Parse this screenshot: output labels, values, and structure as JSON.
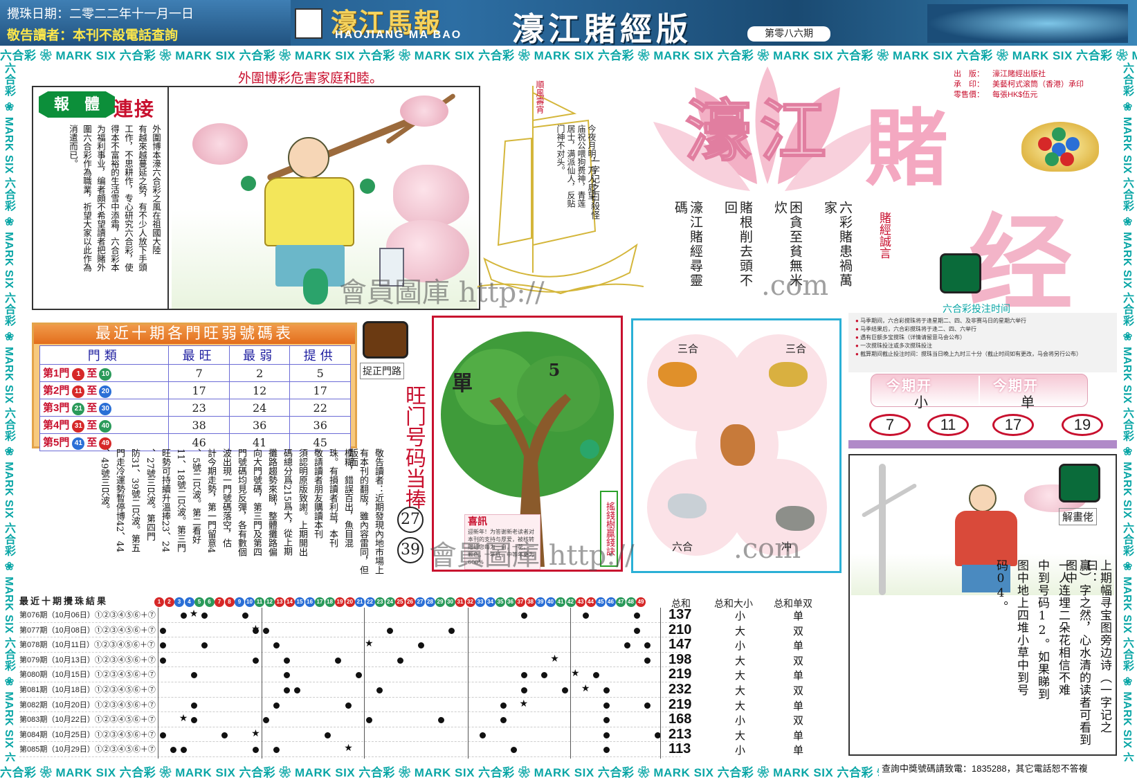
{
  "header": {
    "draw_date": "攪珠日期：二零二二年十一月一日",
    "notice": "敬告讀者：本刊不設電話查詢",
    "logo_cn": "濠江馬報",
    "logo_en": "HAOJIANG MA BAO",
    "edition": "濠江賭經版",
    "issue": "第零八六期"
  },
  "border_text": "六合彩 ❀ MARK SIX 六合彩 ❀ MARK SIX 六合彩 ❀ MARK SIX 六合彩 ❀ MARK SIX 六合彩 ❀ MARK SIX 六合彩 ❀ MARK SIX 六合彩 ❀ MARK SIX 六合彩 ❀ MARK SIX 六合彩 ❀ MARK SIX 六合彩 ❀ MARK SIX 六合彩 ❀",
  "slogan": "外圍博彩危害家庭和睦。",
  "lianjie": {
    "tag1": "報",
    "tag2": "體",
    "title": "連接",
    "body": [
      "外圍博本濠六合彩之風在祖國大陸",
      "有越來越蔓延之勢，有不少人放下手頭",
      "工作，不思耕作，专心研究六合彩，使",
      "得本不富裕的生活雪中添霜，六合彩本",
      "为福利事业，编者頗不希望讀者把賭外",
      "圍六合彩作為職業，祈望大家以此作為",
      "消遣而已。"
    ]
  },
  "ship": {
    "sail_text": "順風壽宵",
    "poem1": "今夜月明，万人启望，庙祝公喂狗费神，青莲居士，满派仙人，反贴门神不对头。",
    "poem2": "一字记之曰殺怪"
  },
  "title": {
    "t1": "濠江",
    "t2": "賭",
    "t3": "经"
  },
  "pub_info": [
    {
      "label": "出　版：",
      "value": "濠江賭經出版社"
    },
    {
      "label": "承　印：",
      "value": "美藝柯式滚筒（香港）承印"
    },
    {
      "label": "零售價：",
      "value": "每張HK$伍元"
    }
  ],
  "mottos": [
    "六彩賭患禍萬家",
    "困貪至貧無米炊",
    "賭根削去頭不回",
    "濠江賭經尋靈碼"
  ],
  "motto_red": "賭經誠言",
  "schedule": {
    "title": "六合彩投注时间",
    "items": [
      "马季期间，六合彩搅珠将于逢星期二、四、及非赛马日的星期六举行",
      "马季结果后，六合彩搅珠将于逢二、四、六举行",
      "遇有巨额多宝搅珠（详情请留意马会公布）",
      "一次搅珠投注或多次搅珠投注",
      "截算期间截止投注时间：搅珠当日晚上九时三十分（截止时间如有更改，马会将另行公布）"
    ]
  },
  "this_period": {
    "label1": "今期开",
    "value1": "小",
    "label2": "今期开",
    "value2": "单",
    "numbers": [
      "7",
      "11",
      "17",
      "19"
    ]
  },
  "hot_cold": {
    "title": "最近十期各門旺弱號碼表",
    "headers": [
      "門類",
      "最旺",
      "最弱",
      "提供"
    ],
    "rows": [
      {
        "gate": "第1門",
        "from": "1",
        "to": "10",
        "hot": "7",
        "cold": "2",
        "give": "5"
      },
      {
        "gate": "第2門",
        "from": "11",
        "to": "20",
        "hot": "17",
        "cold": "12",
        "give": "17"
      },
      {
        "gate": "第3門",
        "from": "21",
        "to": "30",
        "hot": "23",
        "cold": "24",
        "give": "22"
      },
      {
        "gate": "第4門",
        "from": "31",
        "to": "40",
        "hot": "38",
        "cold": "36",
        "give": "36"
      },
      {
        "gate": "第5門",
        "from": "41",
        "to": "49",
        "hot": "46",
        "cold": "41",
        "give": "45"
      }
    ],
    "to_word": "至"
  },
  "catch_gate": {
    "label": "捉正門路",
    "notice_cols": [
      "敬告讀者：近期發現內地市場上",
      "有本刊的翻版，雖內容雷同，但版面",
      "模糊，錯誤百出，魚目混",
      "珠。有損讀者利益，本刊",
      "敬請讀者朋友購讀本刊",
      "須認明原版致謝。上期開出",
      "碼總分爲215爲大，從上期",
      "攤路趨勢來睇，整體攤路偏",
      "向大門號碼，第三門及第四",
      "門號碼均見反彈，各有數個",
      "波出現一門號碼落空，估",
      "計今期走勢，第一門留意4",
      "、5號二只波。第二看好",
      "11、18號二只波。第三門",
      "旺勢可持續升溫捧23、24",
      "、27號三只波。第四門",
      "防31、39號二只波。第五",
      "門走冷運勢暫停博42、44",
      "、49號三只波。"
    ],
    "wang_title": "旺门号码当捧",
    "wang_balls": [
      "27",
      "39"
    ]
  },
  "money_tree": {
    "dan": "單",
    "five": "5",
    "side": "搖錢樹贏錢訣",
    "xixun_title": "喜訊",
    "xixun_body": "迎新年！为答谢新老读者对本刊的支持与厚爱，被核转赠给您每为一自，一花，一颗色，一年红，中等年更为600%"
  },
  "zodiac": {
    "top_left": "三合",
    "top_right": "三合",
    "bottom_left": "六合",
    "bottom_right": "冲"
  },
  "results": {
    "title": "最近十期攪珠結果",
    "ball_count": 49,
    "sum_headers": [
      "总和",
      "总和大小",
      "总和单双"
    ],
    "rows": [
      {
        "label": "第076期（10月06日）①②③④⑤⑥＋⑦",
        "sum": "137",
        "size": "小",
        "oe": "单"
      },
      {
        "label": "第077期（10月08日）①②③④⑤⑥＋⑦",
        "sum": "210",
        "size": "大",
        "oe": "双"
      },
      {
        "label": "第078期（10月11日）①②③④⑤⑥＋⑦",
        "sum": "147",
        "size": "小",
        "oe": "单"
      },
      {
        "label": "第079期（10月13日）①②③④⑤⑥＋⑦",
        "sum": "198",
        "size": "大",
        "oe": "双"
      },
      {
        "label": "第080期（10月15日）①②③④⑤⑥＋⑦",
        "sum": "219",
        "size": "大",
        "oe": "单"
      },
      {
        "label": "第081期（10月18日）①②③④⑤⑥＋⑦",
        "sum": "232",
        "size": "大",
        "oe": "双"
      },
      {
        "label": "第082期（10月20日）①②③④⑤⑥＋⑦",
        "sum": "219",
        "size": "大",
        "oe": "单"
      },
      {
        "label": "第083期（10月22日）①②③④⑤⑥＋⑦",
        "sum": "168",
        "size": "小",
        "oe": "双"
      },
      {
        "label": "第084期（10月25日）①②③④⑤⑥＋⑦",
        "sum": "213",
        "size": "大",
        "oe": "单"
      },
      {
        "label": "第085期（10月29日）①②③④⑤⑥＋⑦",
        "sum": "113",
        "size": "小",
        "oe": "单"
      }
    ]
  },
  "jie_hua": {
    "label": "解畫佬",
    "cols": [
      "上期幅寻宝图旁边诗（一字记之曰：",
      "贏）字之然，心水清的读者可看到图中",
      "一人连埋二朵花相信不难",
      "中到号码12。如果睇到",
      "图中地上四堆小草中到号",
      "码04。"
    ]
  },
  "footer_note": "查詢中獎號碼請致電：1835288，其它電話恕不答複",
  "watermarks": [
    "會員圖庫 http://",
    ".com",
    "會員圖庫 http://",
    ".com"
  ],
  "colors": {
    "red": "#c8102e",
    "teal": "#0aa6a6",
    "pink": "#f4a8c1",
    "blue_border": "#2ab0d6"
  }
}
